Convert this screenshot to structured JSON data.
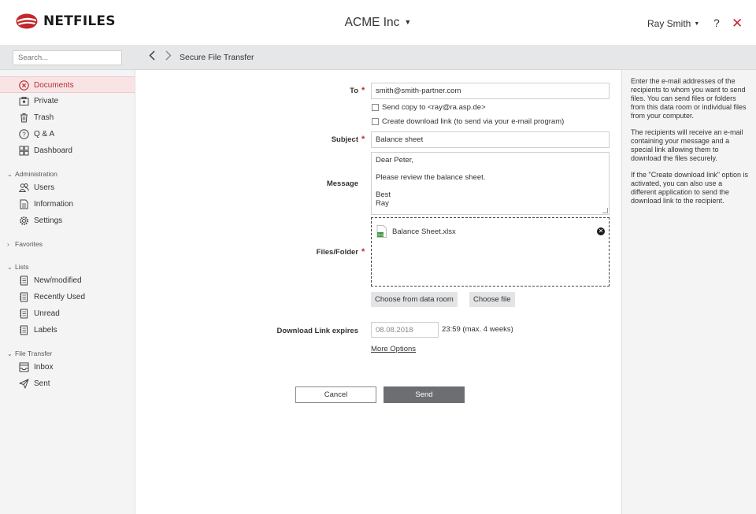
{
  "header": {
    "logo_text": "NETFILES",
    "company": "ACME Inc",
    "user": "Ray Smith",
    "help": "?",
    "close": "✕",
    "accent_color": "#c0282d"
  },
  "toolbar": {
    "search_placeholder": "Search...",
    "back": "‹",
    "forward": "›",
    "breadcrumb": "Secure File Transfer"
  },
  "sidebar": {
    "items": [
      {
        "label": "Documents",
        "icon": "documents-icon"
      },
      {
        "label": "Private",
        "icon": "private-icon"
      },
      {
        "label": "Trash",
        "icon": "trash-icon"
      },
      {
        "label": "Q & A",
        "icon": "question-icon"
      },
      {
        "label": "Dashboard",
        "icon": "dashboard-icon"
      }
    ],
    "administration": {
      "title": "Administration",
      "items": [
        {
          "label": "Users",
          "icon": "users-icon"
        },
        {
          "label": "Information",
          "icon": "information-icon"
        },
        {
          "label": "Settings",
          "icon": "gear-icon"
        }
      ]
    },
    "favorites": {
      "title": "Favorites"
    },
    "lists": {
      "title": "Lists",
      "items": [
        {
          "label": "New/modified",
          "icon": "list-icon"
        },
        {
          "label": "Recently Used",
          "icon": "list-icon"
        },
        {
          "label": "Unread",
          "icon": "list-icon"
        },
        {
          "label": "Labels",
          "icon": "list-icon"
        }
      ]
    },
    "file_transfer": {
      "title": "File Transfer",
      "items": [
        {
          "label": "Inbox",
          "icon": "inbox-icon"
        },
        {
          "label": "Sent",
          "icon": "sent-icon"
        }
      ]
    }
  },
  "form": {
    "to_label": "To",
    "to_value": "smith@smith-partner.com",
    "send_copy": "Send copy to <ray@ra.asp.de>",
    "create_link": "Create download link (to send via your e-mail program)",
    "subject_label": "Subject",
    "subject_value": "Balance sheet",
    "message_label": "Message",
    "message_lines": [
      "Dear Peter,",
      "",
      "Please review the balance sheet.",
      "",
      "Best",
      "Ray"
    ],
    "files_label": "Files/Folder",
    "file_name": "Balance Sheet.xlsx",
    "choose_data_room": "Choose from data room",
    "choose_file": "Choose file",
    "expires_label": "Download Link expires",
    "expires_date": "08.08.2018",
    "expires_time": "23:59 (max. 4 weeks)",
    "more_options": "More Options",
    "cancel": "Cancel",
    "send": "Send"
  },
  "help_panel": {
    "paragraphs": [
      "Enter the e-mail addresses of the recipients to whom you want to send files. You can send files or folders from this data room or individual files from your computer.",
      "The recipients will receive an e-mail containing your message and a special link allowing them to download the files securely.",
      "If the \"Create download link\" option is activated, you can also use a different application to send the download link to the recipient."
    ]
  }
}
